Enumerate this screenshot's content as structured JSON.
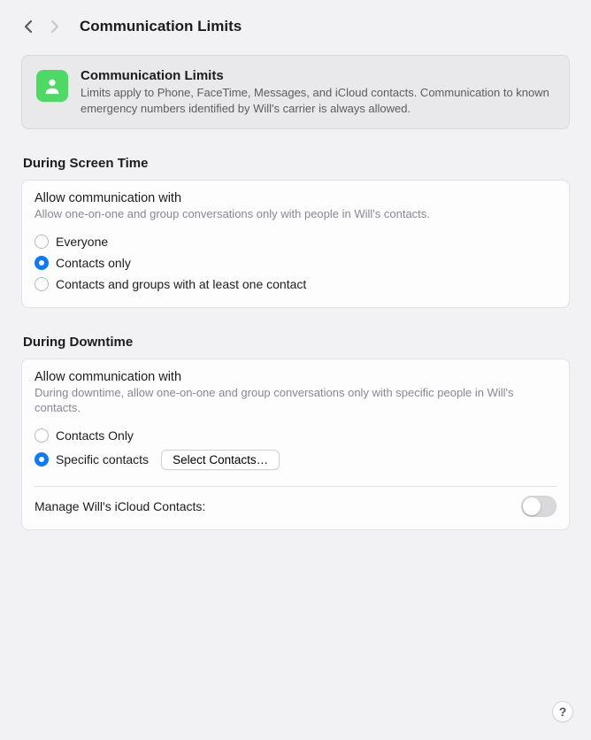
{
  "header": {
    "title": "Communication Limits"
  },
  "info": {
    "title": "Communication Limits",
    "desc": "Limits apply to Phone, FaceTime, Messages, and iCloud contacts. Communication to known emergency numbers identified by Will's carrier is always allowed."
  },
  "sections": {
    "screenTime": {
      "header": "During Screen Time",
      "subTitle": "Allow communication with",
      "subDesc": "Allow one-on-one and group conversations only with people in Will's contacts.",
      "options": {
        "everyone": "Everyone",
        "contactsOnly": "Contacts only",
        "contactsGroups": "Contacts and groups with at least one contact"
      }
    },
    "downtime": {
      "header": "During Downtime",
      "subTitle": "Allow communication with",
      "subDesc": "During downtime, allow one-on-one and group conversations only with specific people in Will's contacts.",
      "options": {
        "contactsOnly": "Contacts Only",
        "specificContacts": "Specific contacts"
      },
      "selectButton": "Select Contacts…",
      "manageLabel": "Manage Will's iCloud Contacts:"
    }
  },
  "help": "?"
}
